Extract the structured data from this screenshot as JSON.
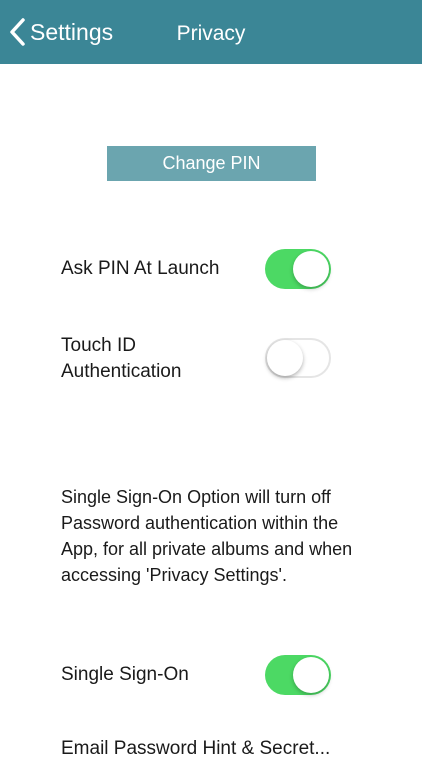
{
  "navbar": {
    "back_label": "Settings",
    "title": "Privacy",
    "color": "#3b8696"
  },
  "change_pin": {
    "label": "Change PIN",
    "color": "#6ba5af"
  },
  "settings": [
    {
      "label": "Ask PIN At Launch",
      "state": "on"
    },
    {
      "label": "Touch ID Authentication",
      "state": "off"
    },
    {
      "label": "Single Sign-On",
      "state": "on"
    }
  ],
  "sso_info": "Single Sign-On Option will turn off Password authentication within the App, for all private albums and when accessing 'Privacy Settings'.",
  "partial_label": "Email Password Hint & Secret...",
  "toggle_on_color": "#4cd964"
}
